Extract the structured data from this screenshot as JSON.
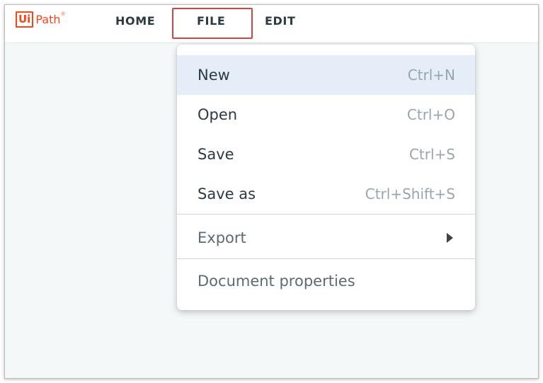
{
  "app": {
    "logo": {
      "boxed": "Ui",
      "text": "Path",
      "reg": "®"
    },
    "brand_color": "#fa4616"
  },
  "nav": {
    "home": "HOME",
    "file": "FILE",
    "edit": "EDIT",
    "active": "FILE",
    "highlight_color": "#d9433f"
  },
  "file_menu": {
    "items": [
      {
        "label": "New",
        "shortcut": "Ctrl+N",
        "highlighted": true
      },
      {
        "label": "Open",
        "shortcut": "Ctrl+O"
      },
      {
        "label": "Save",
        "shortcut": "Ctrl+S"
      },
      {
        "label": "Save as",
        "shortcut": "Ctrl+Shift+S"
      },
      {
        "label": "Export",
        "submenu": true,
        "icon": "chevron-right-icon"
      },
      {
        "label": "Document properties"
      }
    ]
  }
}
